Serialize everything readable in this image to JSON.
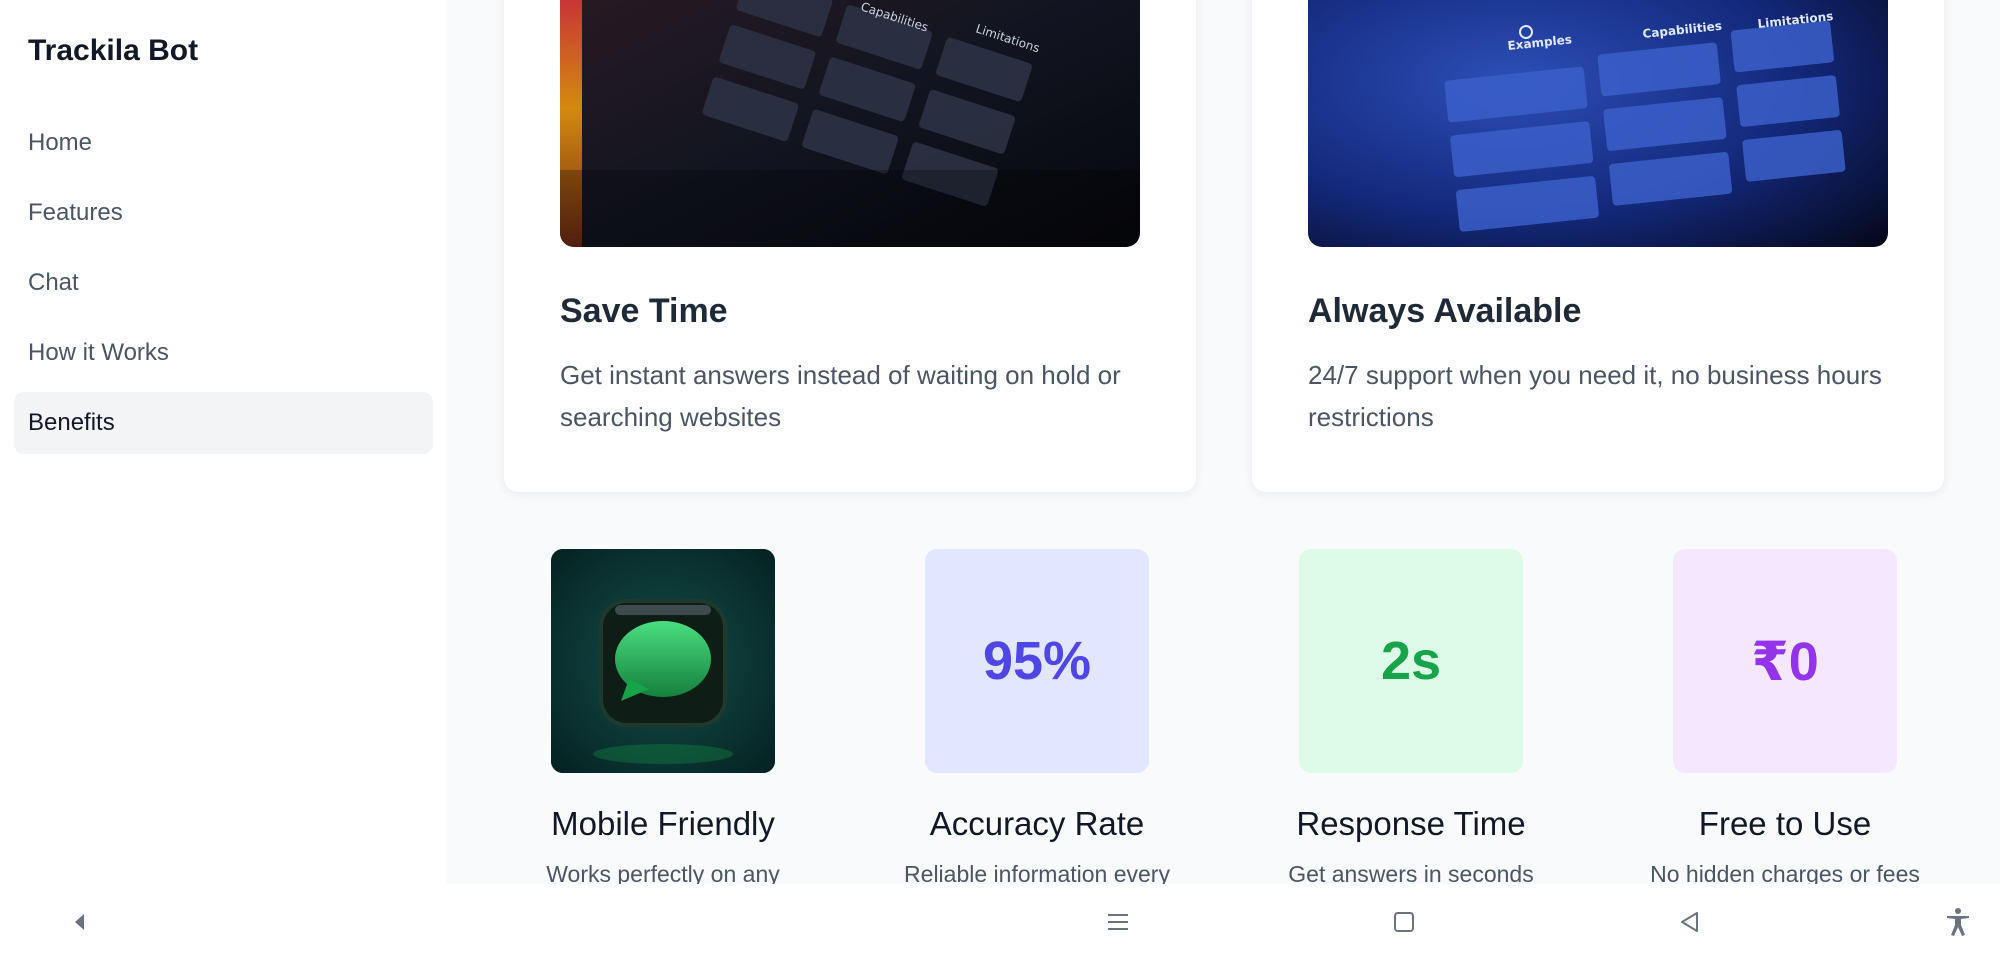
{
  "sidebar": {
    "brand": "Trackila Bot",
    "items": [
      {
        "label": "Home"
      },
      {
        "label": "Features"
      },
      {
        "label": "Chat"
      },
      {
        "label": "How it Works"
      },
      {
        "label": "Benefits"
      }
    ]
  },
  "cards": [
    {
      "title": "Save Time",
      "description": "Get instant answers instead of waiting on hold or searching websites"
    },
    {
      "title": "Always Available",
      "description": "24/7 support when you need it, no business hours restrictions"
    }
  ],
  "stats": [
    {
      "value": "",
      "title": "Mobile Friendly",
      "description": "Works perfectly on any",
      "bg": "#0b2a2a",
      "color": "#22c55e",
      "icon": "chat-bubble-icon"
    },
    {
      "value": "95%",
      "title": "Accuracy Rate",
      "description": "Reliable information every",
      "bg": "#e0e7ff",
      "color": "#4f46e5"
    },
    {
      "value": "2s",
      "title": "Response Time",
      "description": "Get answers in seconds",
      "bg": "#dcfce7",
      "color": "#16a34a"
    },
    {
      "value": "₹0",
      "title": "Free to Use",
      "description": "No hidden charges or fees",
      "bg": "#f3e8ff",
      "color": "#9333ea"
    }
  ],
  "screenshot_headers": [
    "Examples",
    "Capabilities",
    "Limitations"
  ],
  "system_bar": {
    "icons": [
      "back-arrow-icon",
      "menu-icon",
      "home-square-icon",
      "back-triangle-icon",
      "accessibility-icon"
    ]
  }
}
